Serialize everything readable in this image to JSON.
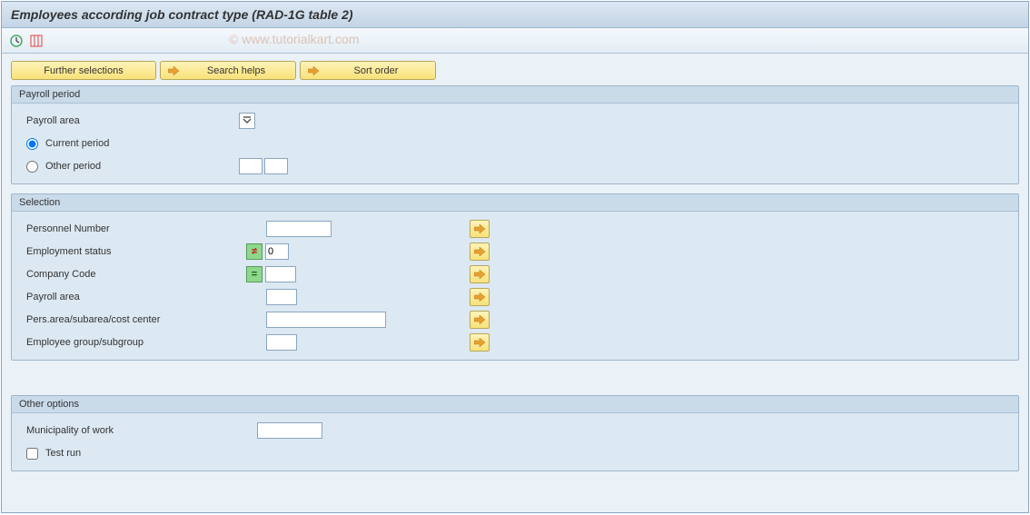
{
  "titlebar": {
    "title": "Employees according job contract type (RAD-1G table 2)"
  },
  "watermark": "© www.tutorialkart.com",
  "toolbar_buttons": {
    "further_selections": "Further selections",
    "search_helps": "Search helps",
    "sort_order": "Sort order"
  },
  "groups": {
    "payroll_period": {
      "title": "Payroll period",
      "payroll_area_label": "Payroll area",
      "current_period_label": "Current period",
      "other_period_label": "Other period"
    },
    "selection": {
      "title": "Selection",
      "personnel_number_label": "Personnel Number",
      "employment_status_label": "Employment status",
      "employment_status_value": "0",
      "company_code_label": "Company Code",
      "payroll_area_label": "Payroll area",
      "pers_area_label": "Pers.area/subarea/cost center",
      "employee_group_label": "Employee group/subgroup"
    },
    "other_options": {
      "title": "Other options",
      "municipality_label": "Municipality of work",
      "test_run_label": "Test run"
    }
  },
  "indicators": {
    "neq": "≠",
    "eq": "="
  }
}
